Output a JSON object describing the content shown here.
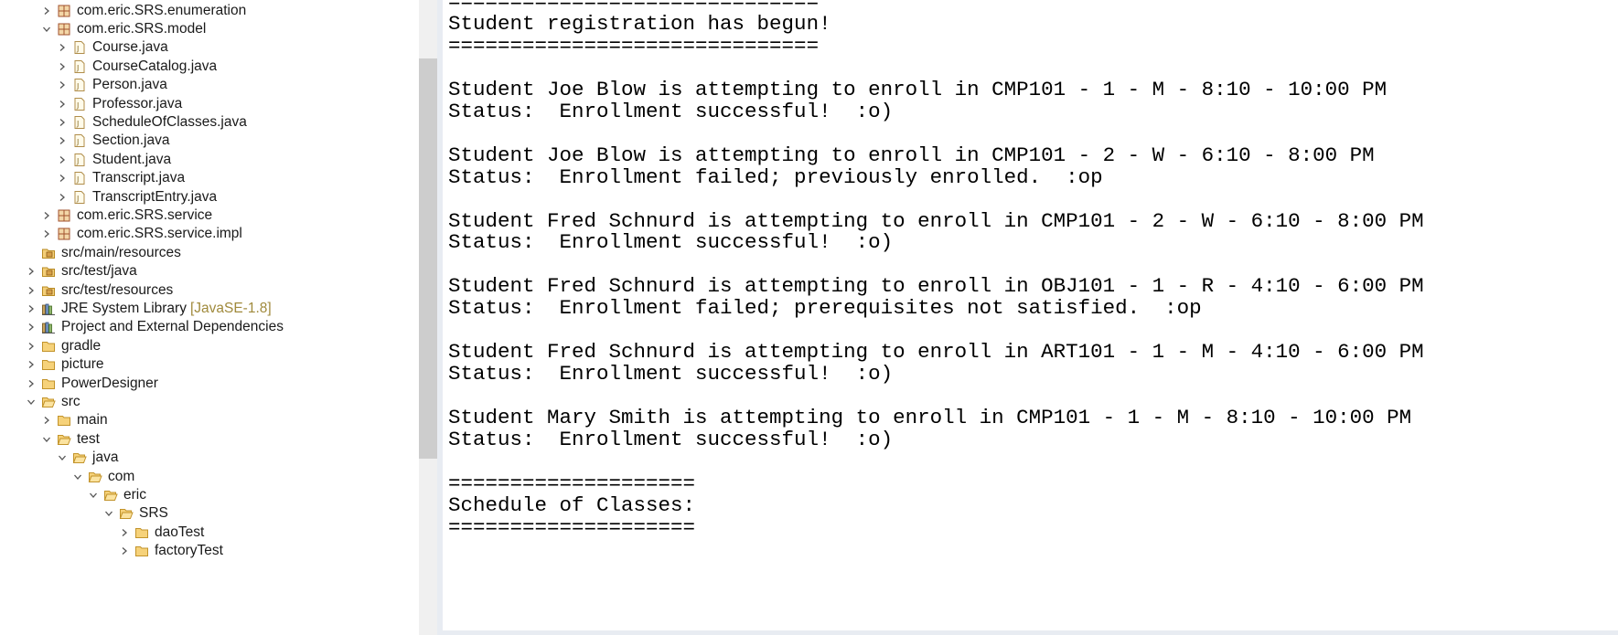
{
  "explorer": {
    "items": [
      {
        "label": "com.eric.SRS.enumeration",
        "kind": "package",
        "expander": "collapsed",
        "depth": 2
      },
      {
        "label": "com.eric.SRS.model",
        "kind": "package",
        "expander": "expanded",
        "depth": 2
      },
      {
        "label": "Course.java",
        "kind": "java-file",
        "expander": "collapsed",
        "depth": 3
      },
      {
        "label": "CourseCatalog.java",
        "kind": "java-file",
        "expander": "collapsed",
        "depth": 3
      },
      {
        "label": "Person.java",
        "kind": "java-file",
        "expander": "collapsed",
        "depth": 3
      },
      {
        "label": "Professor.java",
        "kind": "java-file",
        "expander": "collapsed",
        "depth": 3
      },
      {
        "label": "ScheduleOfClasses.java",
        "kind": "java-file",
        "expander": "collapsed",
        "depth": 3
      },
      {
        "label": "Section.java",
        "kind": "java-file",
        "expander": "collapsed",
        "depth": 3
      },
      {
        "label": "Student.java",
        "kind": "java-file",
        "expander": "collapsed",
        "depth": 3
      },
      {
        "label": "Transcript.java",
        "kind": "java-file",
        "expander": "collapsed",
        "depth": 3
      },
      {
        "label": "TranscriptEntry.java",
        "kind": "java-file",
        "expander": "collapsed",
        "depth": 3
      },
      {
        "label": "com.eric.SRS.service",
        "kind": "package",
        "expander": "collapsed",
        "depth": 2
      },
      {
        "label": "com.eric.SRS.service.impl",
        "kind": "package",
        "expander": "collapsed",
        "depth": 2
      },
      {
        "label": "src/main/resources",
        "kind": "source-folder",
        "expander": "none",
        "depth": 1
      },
      {
        "label": "src/test/java",
        "kind": "source-folder",
        "expander": "collapsed",
        "depth": 1
      },
      {
        "label": "src/test/resources",
        "kind": "source-folder",
        "expander": "collapsed",
        "depth": 1
      },
      {
        "label": "JRE System Library",
        "decoration": "[JavaSE-1.8]",
        "kind": "library",
        "expander": "collapsed",
        "depth": 1
      },
      {
        "label": "Project and External Dependencies",
        "kind": "library",
        "expander": "collapsed",
        "depth": 1
      },
      {
        "label": "gradle",
        "kind": "folder",
        "expander": "collapsed",
        "depth": 1
      },
      {
        "label": "picture",
        "kind": "folder",
        "expander": "collapsed",
        "depth": 1
      },
      {
        "label": "PowerDesigner",
        "kind": "folder",
        "expander": "collapsed",
        "depth": 1
      },
      {
        "label": "src",
        "kind": "folder-open",
        "expander": "expanded",
        "depth": 1
      },
      {
        "label": "main",
        "kind": "folder",
        "expander": "collapsed",
        "depth": 2
      },
      {
        "label": "test",
        "kind": "folder-open",
        "expander": "expanded",
        "depth": 2
      },
      {
        "label": "java",
        "kind": "folder-open",
        "expander": "expanded",
        "depth": 3
      },
      {
        "label": "com",
        "kind": "folder-open",
        "expander": "expanded",
        "depth": 4
      },
      {
        "label": "eric",
        "kind": "folder-open",
        "expander": "expanded",
        "depth": 5
      },
      {
        "label": "SRS",
        "kind": "folder-open",
        "expander": "expanded",
        "depth": 6
      },
      {
        "label": "daoTest",
        "kind": "folder",
        "expander": "collapsed",
        "depth": 7
      },
      {
        "label": "factoryTest",
        "kind": "folder",
        "expander": "collapsed",
        "depth": 7
      }
    ]
  },
  "console": {
    "lines": [
      {
        "text": "==============================",
        "row": 0
      },
      {
        "text": "Student registration has begun!",
        "row": 1
      },
      {
        "text": "==============================",
        "row": 2
      },
      {
        "text": "Student Joe Blow is attempting to enroll in CMP101 - 1 - M - 8:10 - 10:00 PM",
        "row": 4
      },
      {
        "text": "Status:  Enrollment successful!  :o)",
        "row": 5
      },
      {
        "text": "Student Joe Blow is attempting to enroll in CMP101 - 2 - W - 6:10 - 8:00 PM",
        "row": 7
      },
      {
        "text": "Status:  Enrollment failed; previously enrolled.  :op",
        "row": 8
      },
      {
        "text": "Student Fred Schnurd is attempting to enroll in CMP101 - 2 - W - 6:10 - 8:00 PM",
        "row": 10
      },
      {
        "text": "Status:  Enrollment successful!  :o)",
        "row": 11
      },
      {
        "text": "Student Fred Schnurd is attempting to enroll in OBJ101 - 1 - R - 4:10 - 6:00 PM",
        "row": 13
      },
      {
        "text": "Status:  Enrollment failed; prerequisites not satisfied.  :op",
        "row": 14
      },
      {
        "text": "Student Fred Schnurd is attempting to enroll in ART101 - 1 - M - 4:10 - 6:00 PM",
        "row": 16
      },
      {
        "text": "Status:  Enrollment successful!  :o)",
        "row": 17
      },
      {
        "text": "Student Mary Smith is attempting to enroll in CMP101 - 1 - M - 8:10 - 10:00 PM",
        "row": 19
      },
      {
        "text": "Status:  Enrollment successful!  :o)",
        "row": 20
      },
      {
        "text": "====================",
        "row": 22
      },
      {
        "text": "Schedule of Classes:",
        "row": 23
      },
      {
        "text": "====================",
        "row": 24
      }
    ]
  },
  "colors": {
    "decoration": "#a08a3c",
    "package": "#b5651d",
    "folder": "#e8b84a",
    "java_file": "#c9a05a",
    "scroll_thumb": "#cdcdcd"
  }
}
